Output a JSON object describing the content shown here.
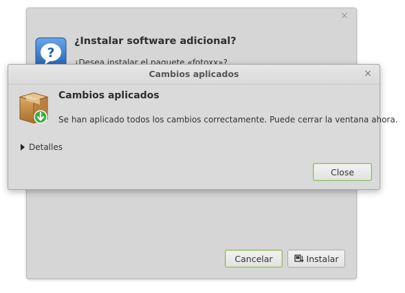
{
  "background_dialog": {
    "close_glyph": "×",
    "title": "¿Instalar software adicional?",
    "message": "¿Desea instalar el paquete «fotoxx»?",
    "icon": "help-icon",
    "buttons": {
      "cancel": "Cancelar",
      "install": "Instalar"
    }
  },
  "front_dialog": {
    "window_title": "Cambios aplicados",
    "close_glyph": "×",
    "icon": "package-icon",
    "heading": "Cambios aplicados",
    "message": "Se han aplicado todos los cambios correctamente. Puede cerrar la ventana ahora.",
    "details_label": "Detalles",
    "close_button": "Close"
  },
  "colors": {
    "dialog_bg": "#dadada",
    "default_button_border": "#8fb566",
    "help_icon_blue": "#2f6fbf"
  }
}
